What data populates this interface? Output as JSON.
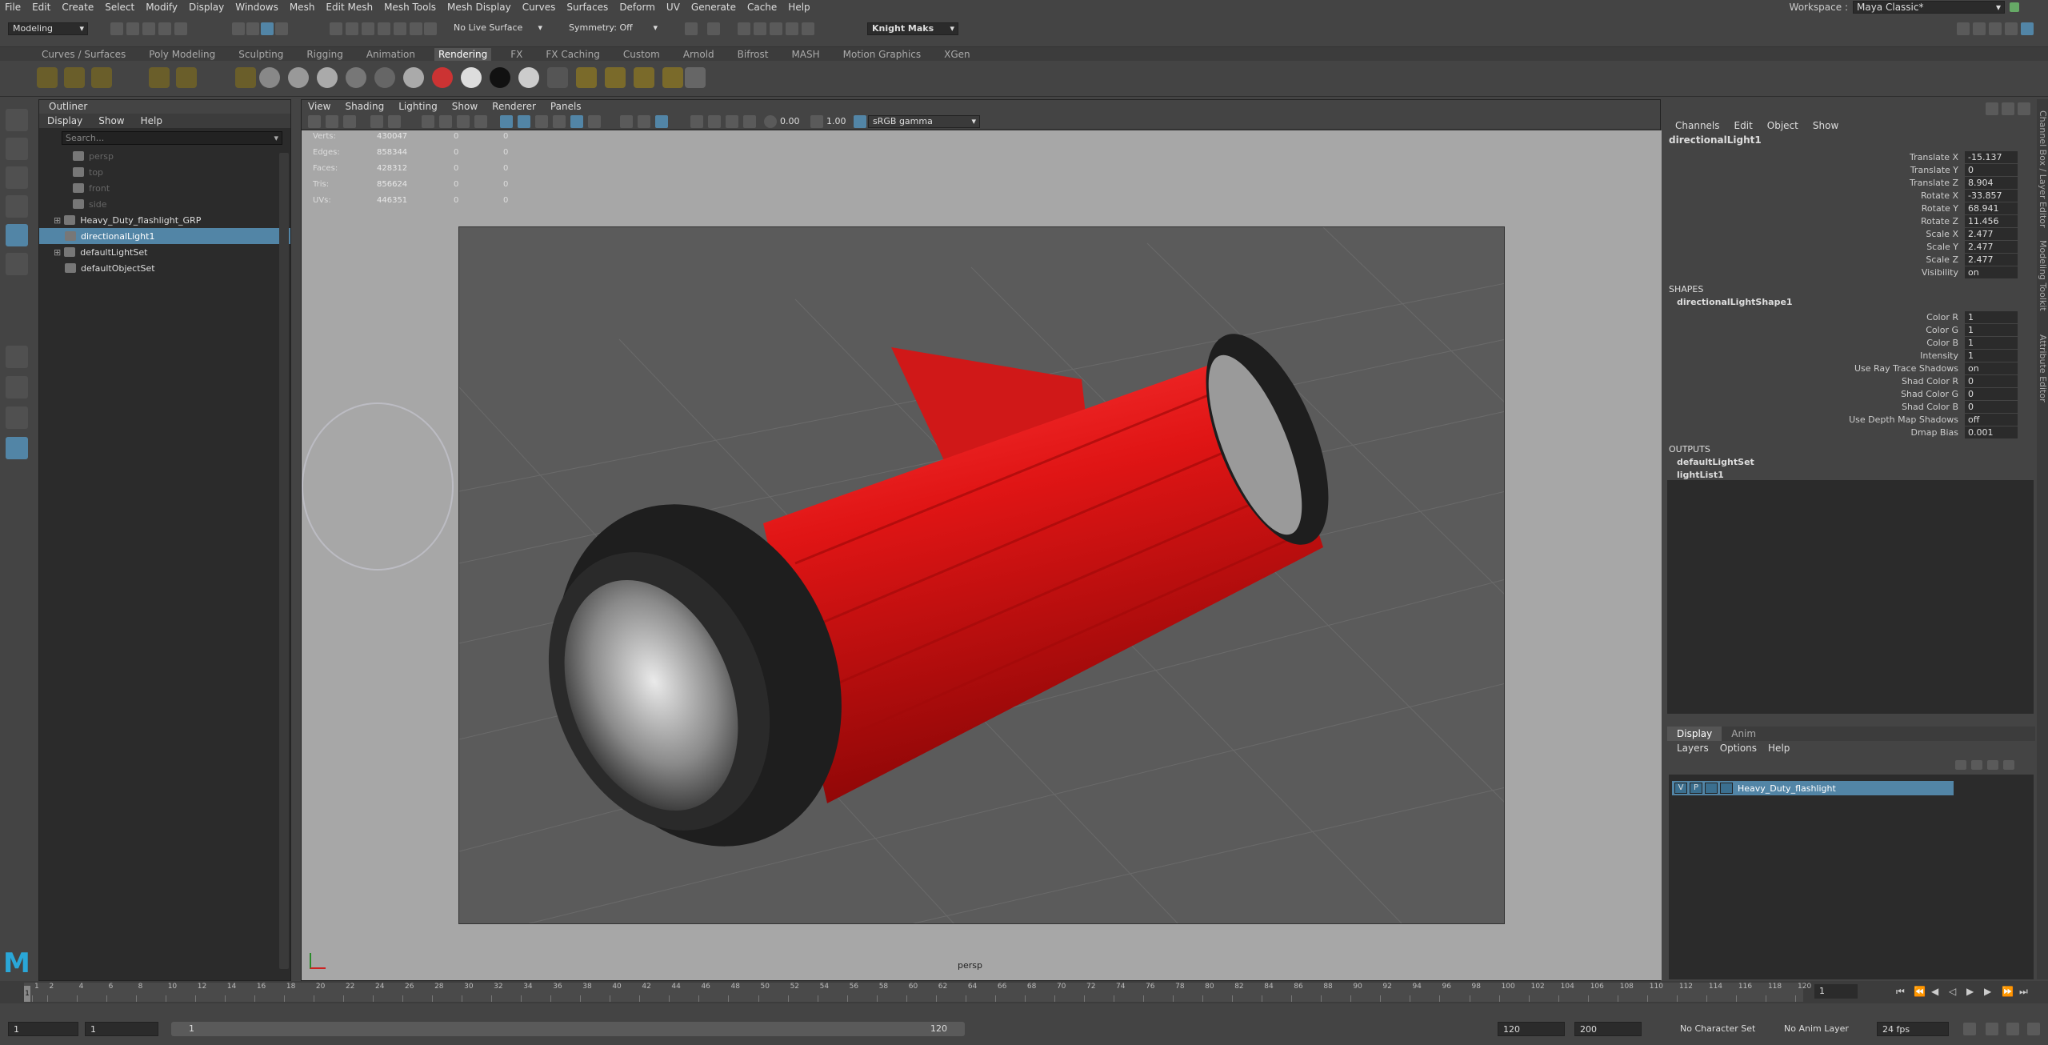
{
  "menu": [
    "File",
    "Edit",
    "Create",
    "Select",
    "Modify",
    "Display",
    "Windows",
    "Mesh",
    "Edit Mesh",
    "Mesh Tools",
    "Mesh Display",
    "Curves",
    "Surfaces",
    "Deform",
    "UV",
    "Generate",
    "Cache",
    "Help"
  ],
  "workspace": {
    "label": "Workspace :",
    "value": "Maya Classic*"
  },
  "status": {
    "mode": "Modeling",
    "live_surface": "No Live Surface",
    "symmetry": "Symmetry: Off",
    "user": "Knight Maks"
  },
  "shelf_tabs": [
    "Curves / Surfaces",
    "Poly Modeling",
    "Sculpting",
    "Rigging",
    "Animation",
    "Rendering",
    "FX",
    "FX Caching",
    "Custom",
    "Arnold",
    "Bifrost",
    "MASH",
    "Motion Graphics",
    "XGen"
  ],
  "shelf_active": "Rendering",
  "outliner": {
    "title": "Outliner",
    "menu": [
      "Display",
      "Show",
      "Help"
    ],
    "search_placeholder": "Search...",
    "items": [
      {
        "label": "persp",
        "dim": true
      },
      {
        "label": "top",
        "dim": true
      },
      {
        "label": "front",
        "dim": true
      },
      {
        "label": "side",
        "dim": true
      },
      {
        "label": "Heavy_Duty_flashlight_GRP",
        "dim": false
      },
      {
        "label": "directionalLight1",
        "dim": false,
        "selected": true
      },
      {
        "label": "defaultLightSet",
        "dim": false
      },
      {
        "label": "defaultObjectSet",
        "dim": false
      }
    ]
  },
  "viewport": {
    "menu": [
      "View",
      "Shading",
      "Lighting",
      "Show",
      "Renderer",
      "Panels"
    ],
    "exposure": "0.00",
    "gamma": "1.00",
    "color_space": "sRGB gamma",
    "camera": "persp",
    "hud": [
      {
        "label": "Verts:",
        "value": "430047",
        "a": "0",
        "b": "0"
      },
      {
        "label": "Edges:",
        "value": "858344",
        "a": "0",
        "b": "0"
      },
      {
        "label": "Faces:",
        "value": "428312",
        "a": "0",
        "b": "0"
      },
      {
        "label": "Tris:",
        "value": "856624",
        "a": "0",
        "b": "0"
      },
      {
        "label": "UVs:",
        "value": "446351",
        "a": "0",
        "b": "0"
      }
    ]
  },
  "channel_box": {
    "menu": [
      "Channels",
      "Edit",
      "Object",
      "Show"
    ],
    "node": "directionalLight1",
    "attrs": [
      {
        "name": "Translate X",
        "value": "-15.137"
      },
      {
        "name": "Translate Y",
        "value": "0"
      },
      {
        "name": "Translate Z",
        "value": "8.904"
      },
      {
        "name": "Rotate X",
        "value": "-33.857"
      },
      {
        "name": "Rotate Y",
        "value": "68.941"
      },
      {
        "name": "Rotate Z",
        "value": "11.456"
      },
      {
        "name": "Scale X",
        "value": "2.477"
      },
      {
        "name": "Scale Y",
        "value": "2.477"
      },
      {
        "name": "Scale Z",
        "value": "2.477"
      },
      {
        "name": "Visibility",
        "value": "on"
      }
    ],
    "shapes_label": "SHAPES",
    "shape_node": "directionalLightShape1",
    "shape_attrs": [
      {
        "name": "Color R",
        "value": "1"
      },
      {
        "name": "Color G",
        "value": "1"
      },
      {
        "name": "Color B",
        "value": "1"
      },
      {
        "name": "Intensity",
        "value": "1"
      },
      {
        "name": "Use Ray Trace Shadows",
        "value": "on"
      },
      {
        "name": "Shad Color R",
        "value": "0"
      },
      {
        "name": "Shad Color G",
        "value": "0"
      },
      {
        "name": "Shad Color B",
        "value": "0"
      },
      {
        "name": "Use Depth Map Shadows",
        "value": "off"
      },
      {
        "name": "Dmap Bias",
        "value": "0.001"
      }
    ],
    "outputs_label": "OUTPUTS",
    "outputs": [
      "defaultLightSet",
      "lightList1"
    ]
  },
  "layers": {
    "tabs": [
      "Display",
      "Anim"
    ],
    "menu": [
      "Layers",
      "Options",
      "Help"
    ],
    "row": {
      "v": "V",
      "p": "P",
      "name": "Heavy_Duty_flashlight"
    }
  },
  "side_tabs": [
    "Channel Box / Layer Editor",
    "Modeling Toolkit",
    "Attribute Editor"
  ],
  "timeline": {
    "ticks": [
      "1",
      "2",
      "4",
      "6",
      "8",
      "10",
      "12",
      "14",
      "16",
      "18",
      "20",
      "22",
      "24",
      "26",
      "28",
      "30",
      "32",
      "34",
      "36",
      "38",
      "40",
      "42",
      "44",
      "46",
      "48",
      "50",
      "52",
      "54",
      "56",
      "58",
      "60",
      "62",
      "64",
      "66",
      "68",
      "70",
      "72",
      "74",
      "76",
      "78",
      "80",
      "82",
      "84",
      "86",
      "88",
      "90",
      "92",
      "94",
      "96",
      "98",
      "100",
      "102",
      "104",
      "106",
      "108",
      "110",
      "112",
      "114",
      "116",
      "118",
      "120"
    ],
    "current": "1"
  },
  "range": {
    "start": "1",
    "playback_start": "1",
    "slider_start": "1",
    "slider_end": "120",
    "playback_end": "120",
    "end": "200",
    "character_set": "No Character Set",
    "anim_layer": "No Anim Layer",
    "fps": "24 fps"
  },
  "colors": {
    "accent": "#5285a6",
    "flashlight_body": "#d11414",
    "flashlight_cap": "#1e1e1e"
  }
}
